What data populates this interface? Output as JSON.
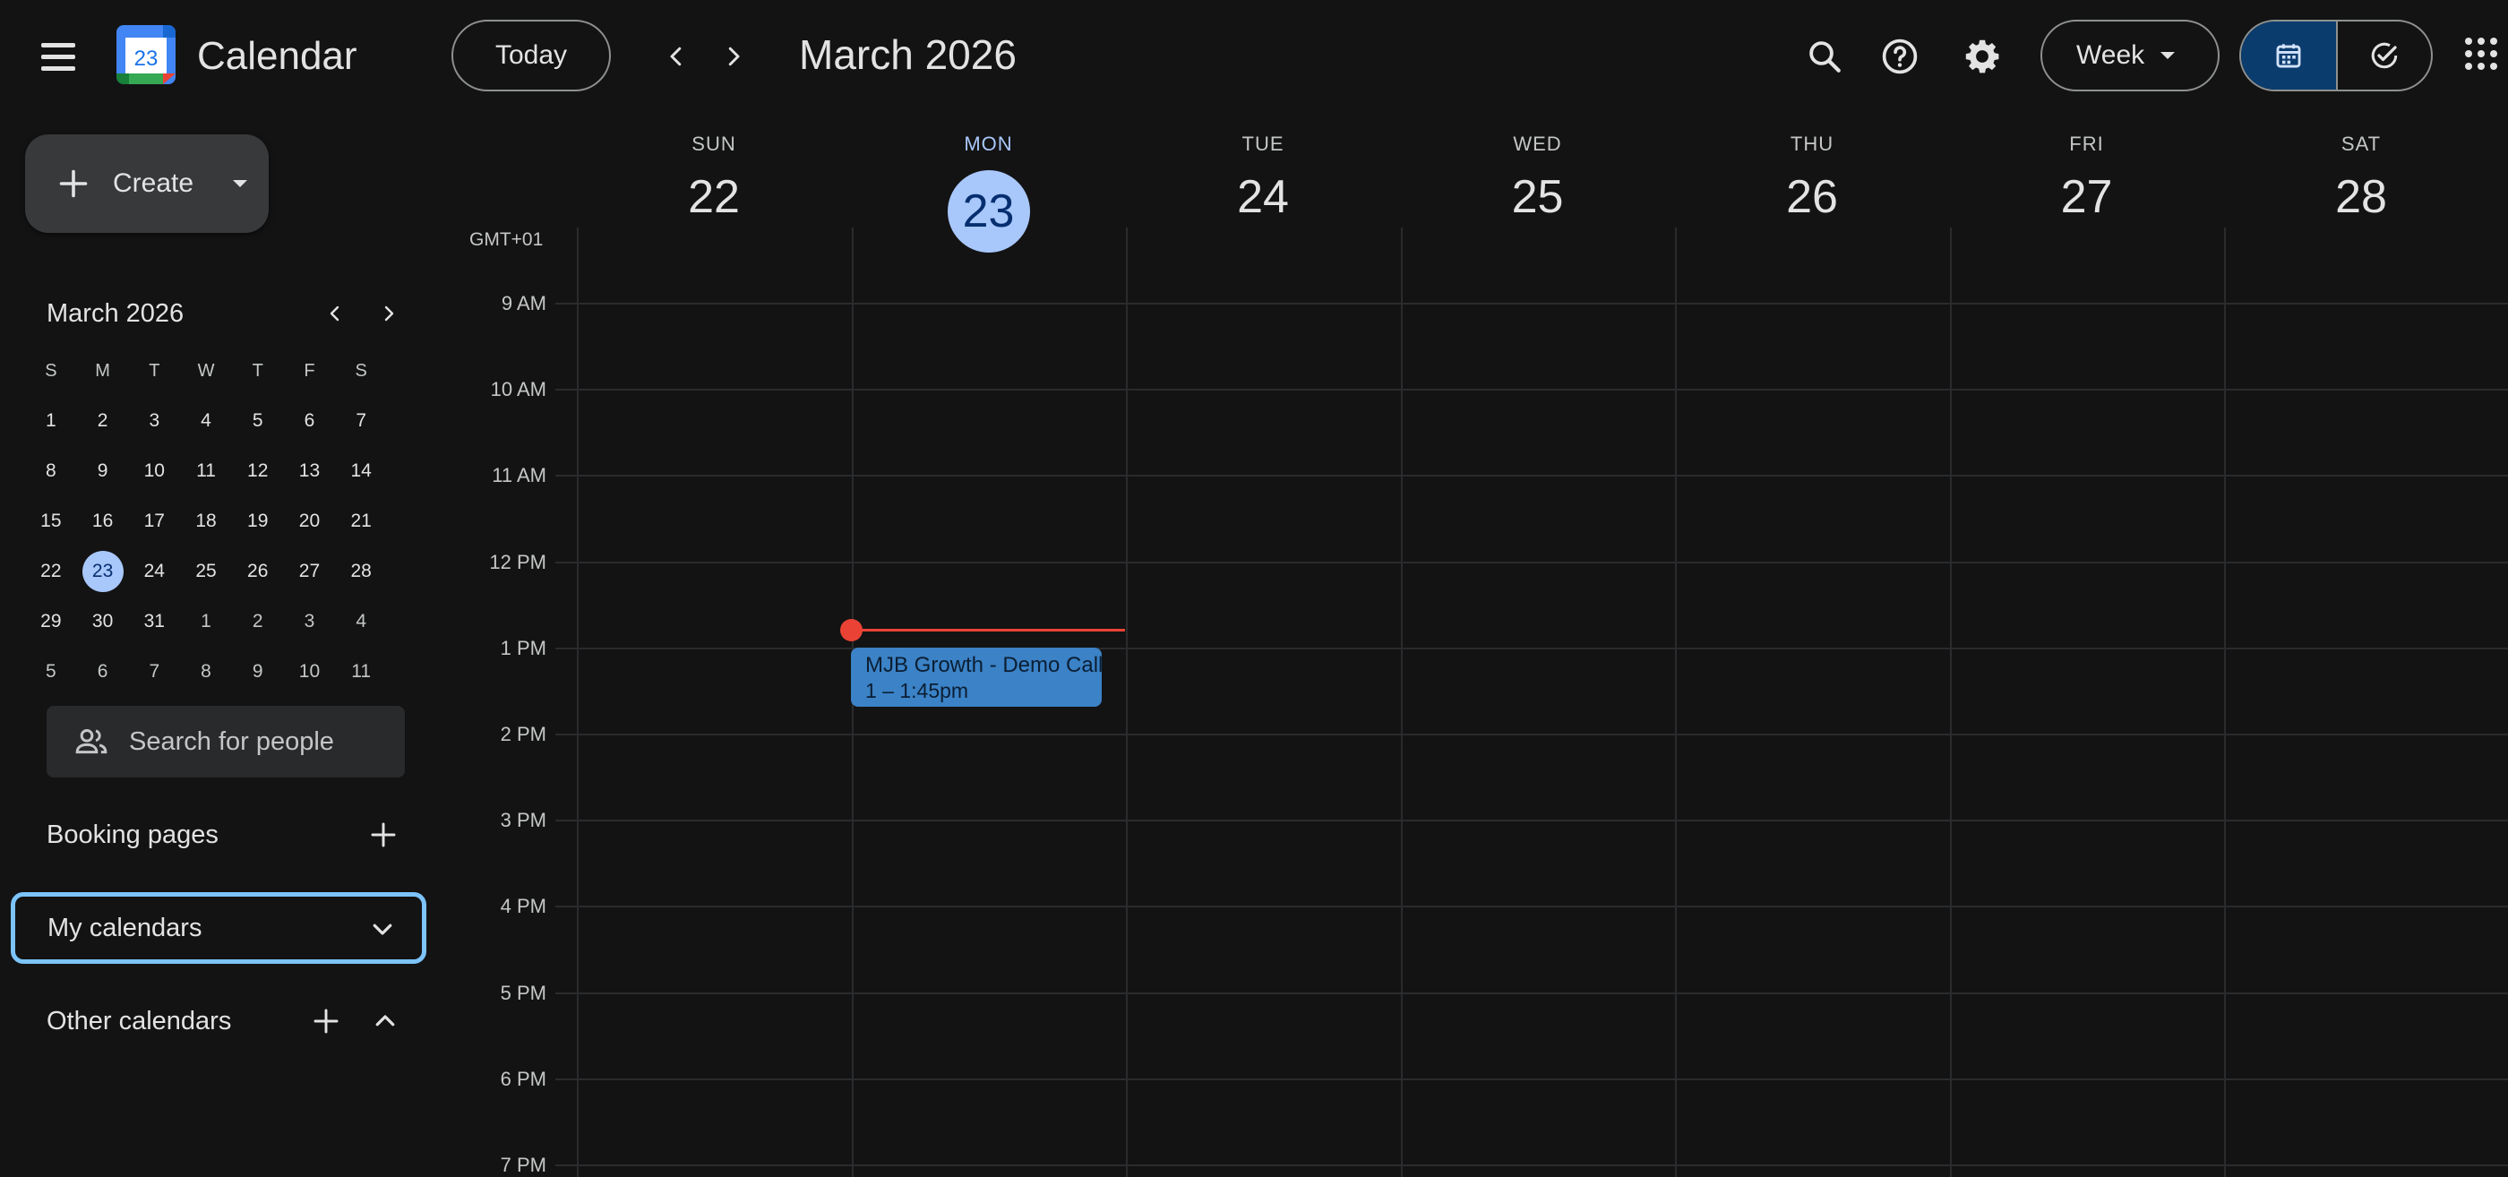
{
  "header": {
    "app_title": "Calendar",
    "logo_day": "23",
    "today_label": "Today",
    "period_label": "March 2026",
    "view_label": "Week"
  },
  "sidebar": {
    "create_label": "Create",
    "mini_calendar": {
      "title": "March 2026",
      "weekdays": [
        "S",
        "M",
        "T",
        "W",
        "T",
        "F",
        "S"
      ],
      "weeks": [
        [
          "1",
          "2",
          "3",
          "4",
          "5",
          "6",
          "7"
        ],
        [
          "8",
          "9",
          "10",
          "11",
          "12",
          "13",
          "14"
        ],
        [
          "15",
          "16",
          "17",
          "18",
          "19",
          "20",
          "21"
        ],
        [
          "22",
          "23",
          "24",
          "25",
          "26",
          "27",
          "28"
        ],
        [
          "29",
          "30",
          "31",
          "1",
          "2",
          "3",
          "4"
        ],
        [
          "5",
          "6",
          "7",
          "8",
          "9",
          "10",
          "11"
        ]
      ],
      "today": "23"
    },
    "people_search_placeholder": "Search for people",
    "booking_pages": "Booking pages",
    "my_calendars": "My calendars",
    "other_calendars": "Other calendars"
  },
  "week": {
    "timezone": "GMT+01",
    "days": [
      {
        "dow": "SUN",
        "dom": "22"
      },
      {
        "dow": "MON",
        "dom": "23",
        "today": true
      },
      {
        "dow": "TUE",
        "dom": "24"
      },
      {
        "dow": "WED",
        "dom": "25"
      },
      {
        "dow": "THU",
        "dom": "26"
      },
      {
        "dow": "FRI",
        "dom": "27"
      },
      {
        "dow": "SAT",
        "dom": "28"
      }
    ],
    "hours": [
      "9 AM",
      "10 AM",
      "11 AM",
      "12 PM",
      "1 PM",
      "2 PM",
      "3 PM",
      "4 PM",
      "5 PM",
      "6 PM",
      "7 PM"
    ]
  },
  "event": {
    "title": "MJB Growth - Demo Call",
    "time": "1 – 1:45pm"
  },
  "colors": {
    "today_accent": "#a8c7fa",
    "event": "#3b82c6",
    "now_line": "#ea4335",
    "focus_ring": "#7cc4fa"
  }
}
